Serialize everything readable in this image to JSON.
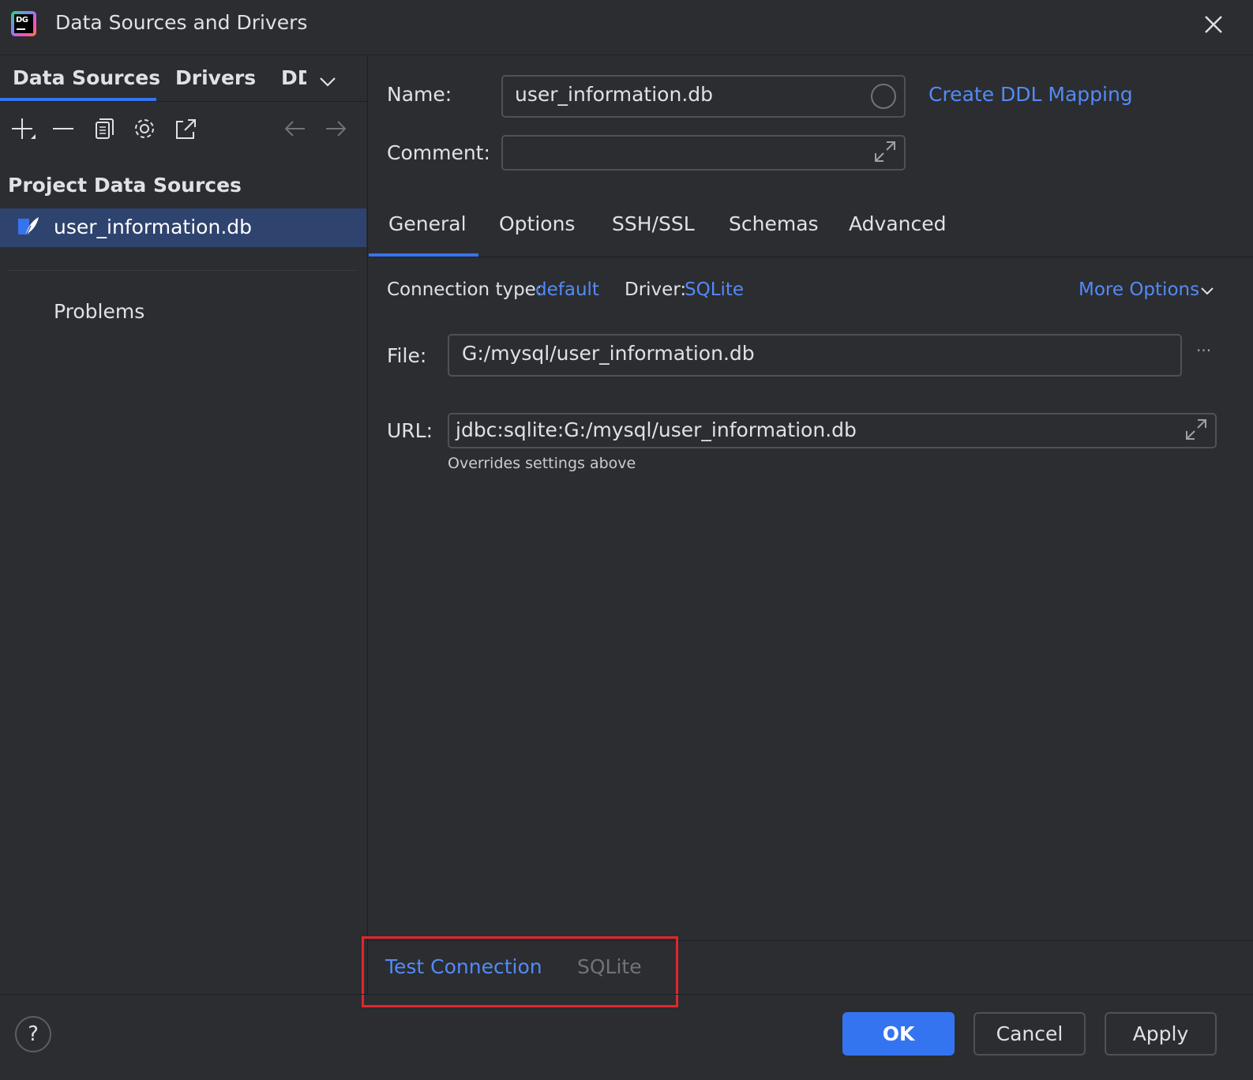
{
  "window": {
    "title": "Data Sources and Drivers",
    "logo_text": "DG"
  },
  "left": {
    "tabs": [
      {
        "label": "Data Sources"
      },
      {
        "label": "Drivers"
      },
      {
        "label": "DDL Mappings"
      }
    ],
    "toolbar_icons": [
      "add-icon",
      "remove-icon",
      "duplicate-icon",
      "settings-icon",
      "export-icon",
      "back-arrow-icon",
      "forward-arrow-icon"
    ],
    "section_title": "Project Data Sources",
    "data_sources": [
      {
        "label": "user_information.db",
        "icon": "sqlite-feather-icon"
      }
    ],
    "problems_label": "Problems"
  },
  "right": {
    "name": {
      "label": "Name:",
      "value": "user_information.db"
    },
    "create_ddl_link": "Create DDL Mapping",
    "comment": {
      "label": "Comment:",
      "value": ""
    },
    "tabs": [
      {
        "label": "General"
      },
      {
        "label": "Options"
      },
      {
        "label": "SSH/SSL"
      },
      {
        "label": "Schemas"
      },
      {
        "label": "Advanced"
      }
    ],
    "connection_type": {
      "label": "Connection type:",
      "value": "default"
    },
    "driver": {
      "label": "Driver:",
      "value": "SQLite"
    },
    "more_options": "More Options",
    "file": {
      "label": "File:",
      "value": "G:/mysql/user_information.db",
      "browse": "···"
    },
    "url": {
      "label": "URL:",
      "value": "jdbc:sqlite:G:/mysql/user_information.db",
      "hint": "Overrides settings above"
    }
  },
  "actions": {
    "test_connection": "Test Connection",
    "driver_name": "SQLite"
  },
  "footer": {
    "help": "?",
    "ok": "OK",
    "cancel": "Cancel",
    "apply": "Apply"
  },
  "colors": {
    "accent": "#3574f0",
    "link": "#548af7",
    "background": "#2b2d30",
    "selection": "#2e436e",
    "highlight": "#e0262f"
  }
}
